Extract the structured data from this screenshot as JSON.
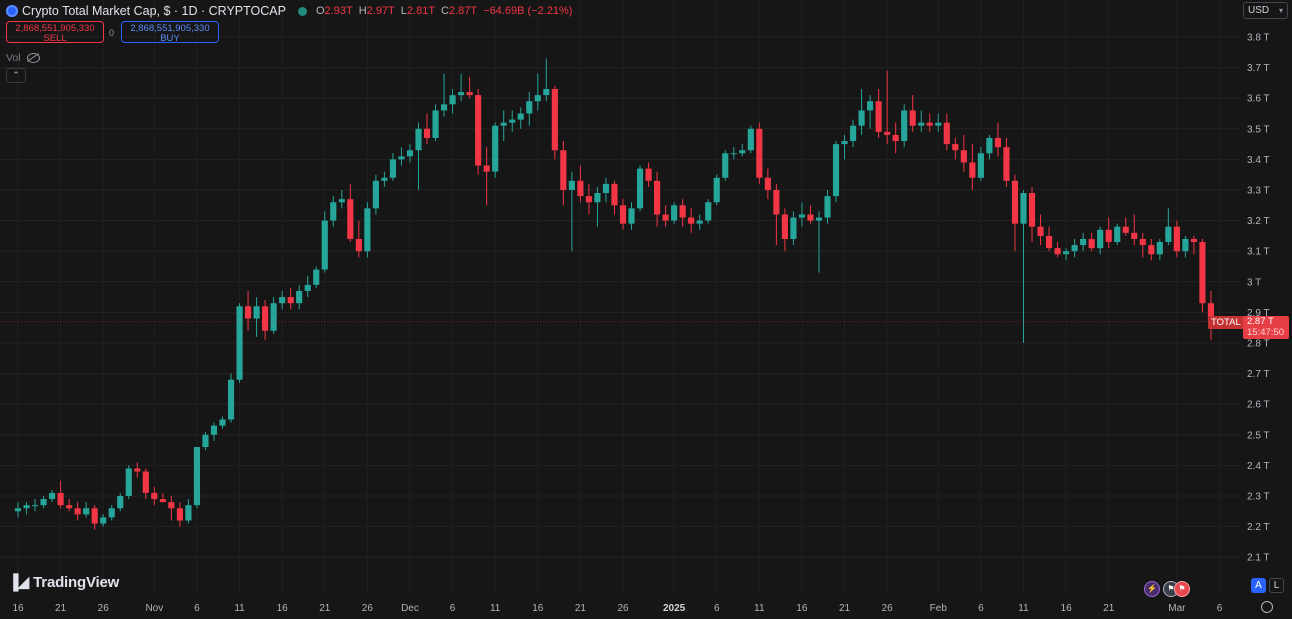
{
  "header": {
    "title": "Crypto Total Market Cap, $ · 1D · CRYPTOCAP",
    "open_label": "O",
    "open": "2.93T",
    "high_label": "H",
    "high": "2.97T",
    "low_label": "L",
    "low": "2.81T",
    "close_label": "C",
    "close": "2.87T",
    "change": "−64.69B (−2.21%)"
  },
  "trade": {
    "sell_price": "2,868,551,905,330",
    "sell_label": "SELL",
    "buy_price": "2,868,551,905,330",
    "buy_label": "BUY",
    "spread": "0"
  },
  "volume_label": "Vol",
  "currency": "USD",
  "brand": "TradingView",
  "price_tag": {
    "symbol": "TOTAL",
    "price": "2.87 T",
    "countdown": "15:47:50"
  },
  "buttons": {
    "auto": "A",
    "log": "L"
  },
  "colors": {
    "up": "#26a69a",
    "down": "#f23645",
    "background": "#161616",
    "accent": "#2962ff"
  },
  "chart_data": {
    "type": "candlestick",
    "title": "Crypto Total Market Cap, $ · 1D · CRYPTOCAP",
    "y_unit": "T (USD trillions)",
    "ylim": [
      2.0,
      3.83
    ],
    "y_ticks": [
      "2.1 T",
      "2.2 T",
      "2.3 T",
      "2.4 T",
      "2.5 T",
      "2.6 T",
      "2.7 T",
      "2.8 T",
      "2.9 T",
      "3 T",
      "3.1 T",
      "3.2 T",
      "3.3 T",
      "3.4 T",
      "3.5 T",
      "3.6 T",
      "3.7 T",
      "3.8 T"
    ],
    "x_ticks": [
      "16",
      "21",
      "26",
      "Nov",
      "6",
      "11",
      "16",
      "21",
      "26",
      "Dec",
      "6",
      "11",
      "16",
      "21",
      "26",
      "2025",
      "6",
      "11",
      "16",
      "21",
      "26",
      "Feb",
      "6",
      "11",
      "16",
      "21",
      "Mar",
      "6"
    ],
    "x_range": [
      "2024-10-16",
      "2025-03-07"
    ],
    "current_price": 2.87,
    "grid": true,
    "candles": [
      {
        "date": "2024-10-16",
        "o": 2.25,
        "h": 2.28,
        "l": 2.23,
        "c": 2.26
      },
      {
        "date": "2024-10-17",
        "o": 2.26,
        "h": 2.28,
        "l": 2.24,
        "c": 2.27
      },
      {
        "date": "2024-10-18",
        "o": 2.27,
        "h": 2.29,
        "l": 2.25,
        "c": 2.27
      },
      {
        "date": "2024-10-19",
        "o": 2.27,
        "h": 2.3,
        "l": 2.26,
        "c": 2.29
      },
      {
        "date": "2024-10-20",
        "o": 2.29,
        "h": 2.32,
        "l": 2.28,
        "c": 2.31
      },
      {
        "date": "2024-10-21",
        "o": 2.31,
        "h": 2.35,
        "l": 2.26,
        "c": 2.27
      },
      {
        "date": "2024-10-22",
        "o": 2.27,
        "h": 2.29,
        "l": 2.25,
        "c": 2.26
      },
      {
        "date": "2024-10-23",
        "o": 2.26,
        "h": 2.28,
        "l": 2.22,
        "c": 2.24
      },
      {
        "date": "2024-10-24",
        "o": 2.24,
        "h": 2.28,
        "l": 2.23,
        "c": 2.26
      },
      {
        "date": "2024-10-25",
        "o": 2.26,
        "h": 2.27,
        "l": 2.19,
        "c": 2.21
      },
      {
        "date": "2024-10-26",
        "o": 2.21,
        "h": 2.24,
        "l": 2.2,
        "c": 2.23
      },
      {
        "date": "2024-10-27",
        "o": 2.23,
        "h": 2.27,
        "l": 2.22,
        "c": 2.26
      },
      {
        "date": "2024-10-28",
        "o": 2.26,
        "h": 2.31,
        "l": 2.25,
        "c": 2.3
      },
      {
        "date": "2024-10-29",
        "o": 2.3,
        "h": 2.4,
        "l": 2.29,
        "c": 2.39
      },
      {
        "date": "2024-10-30",
        "o": 2.39,
        "h": 2.41,
        "l": 2.36,
        "c": 2.38
      },
      {
        "date": "2024-10-31",
        "o": 2.38,
        "h": 2.39,
        "l": 2.29,
        "c": 2.31
      },
      {
        "date": "2024-11-01",
        "o": 2.31,
        "h": 2.33,
        "l": 2.27,
        "c": 2.29
      },
      {
        "date": "2024-11-02",
        "o": 2.29,
        "h": 2.31,
        "l": 2.28,
        "c": 2.28
      },
      {
        "date": "2024-11-03",
        "o": 2.28,
        "h": 2.3,
        "l": 2.22,
        "c": 2.26
      },
      {
        "date": "2024-11-04",
        "o": 2.26,
        "h": 2.28,
        "l": 2.2,
        "c": 2.22
      },
      {
        "date": "2024-11-05",
        "o": 2.22,
        "h": 2.29,
        "l": 2.21,
        "c": 2.27
      },
      {
        "date": "2024-11-06",
        "o": 2.27,
        "h": 2.46,
        "l": 2.26,
        "c": 2.46
      },
      {
        "date": "2024-11-07",
        "o": 2.46,
        "h": 2.51,
        "l": 2.45,
        "c": 2.5
      },
      {
        "date": "2024-11-08",
        "o": 2.5,
        "h": 2.54,
        "l": 2.48,
        "c": 2.53
      },
      {
        "date": "2024-11-09",
        "o": 2.53,
        "h": 2.56,
        "l": 2.52,
        "c": 2.55
      },
      {
        "date": "2024-11-10",
        "o": 2.55,
        "h": 2.7,
        "l": 2.54,
        "c": 2.68
      },
      {
        "date": "2024-11-11",
        "o": 2.68,
        "h": 2.93,
        "l": 2.67,
        "c": 2.92
      },
      {
        "date": "2024-11-12",
        "o": 2.92,
        "h": 2.97,
        "l": 2.84,
        "c": 2.88
      },
      {
        "date": "2024-11-13",
        "o": 2.88,
        "h": 2.95,
        "l": 2.82,
        "c": 2.92
      },
      {
        "date": "2024-11-14",
        "o": 2.92,
        "h": 2.94,
        "l": 2.81,
        "c": 2.84
      },
      {
        "date": "2024-11-15",
        "o": 2.84,
        "h": 2.95,
        "l": 2.83,
        "c": 2.93
      },
      {
        "date": "2024-11-16",
        "o": 2.93,
        "h": 2.97,
        "l": 2.91,
        "c": 2.95
      },
      {
        "date": "2024-11-17",
        "o": 2.95,
        "h": 2.98,
        "l": 2.91,
        "c": 2.93
      },
      {
        "date": "2024-11-18",
        "o": 2.93,
        "h": 2.99,
        "l": 2.91,
        "c": 2.97
      },
      {
        "date": "2024-11-19",
        "o": 2.97,
        "h": 3.02,
        "l": 2.95,
        "c": 2.99
      },
      {
        "date": "2024-11-20",
        "o": 2.99,
        "h": 3.05,
        "l": 2.98,
        "c": 3.04
      },
      {
        "date": "2024-11-21",
        "o": 3.04,
        "h": 3.23,
        "l": 3.03,
        "c": 3.2
      },
      {
        "date": "2024-11-22",
        "o": 3.2,
        "h": 3.28,
        "l": 3.18,
        "c": 3.26
      },
      {
        "date": "2024-11-23",
        "o": 3.26,
        "h": 3.3,
        "l": 3.24,
        "c": 3.27
      },
      {
        "date": "2024-11-24",
        "o": 3.27,
        "h": 3.32,
        "l": 3.13,
        "c": 3.14
      },
      {
        "date": "2024-11-25",
        "o": 3.14,
        "h": 3.2,
        "l": 3.08,
        "c": 3.1
      },
      {
        "date": "2024-11-26",
        "o": 3.1,
        "h": 3.26,
        "l": 3.08,
        "c": 3.24
      },
      {
        "date": "2024-11-27",
        "o": 3.24,
        "h": 3.35,
        "l": 3.22,
        "c": 3.33
      },
      {
        "date": "2024-11-28",
        "o": 3.33,
        "h": 3.36,
        "l": 3.31,
        "c": 3.34
      },
      {
        "date": "2024-11-29",
        "o": 3.34,
        "h": 3.42,
        "l": 3.33,
        "c": 3.4
      },
      {
        "date": "2024-11-30",
        "o": 3.4,
        "h": 3.44,
        "l": 3.38,
        "c": 3.41
      },
      {
        "date": "2024-12-01",
        "o": 3.41,
        "h": 3.45,
        "l": 3.39,
        "c": 3.43
      },
      {
        "date": "2024-12-02",
        "o": 3.43,
        "h": 3.52,
        "l": 3.3,
        "c": 3.5
      },
      {
        "date": "2024-12-03",
        "o": 3.5,
        "h": 3.55,
        "l": 3.45,
        "c": 3.47
      },
      {
        "date": "2024-12-04",
        "o": 3.47,
        "h": 3.58,
        "l": 3.46,
        "c": 3.56
      },
      {
        "date": "2024-12-05",
        "o": 3.56,
        "h": 3.68,
        "l": 3.54,
        "c": 3.58
      },
      {
        "date": "2024-12-06",
        "o": 3.58,
        "h": 3.63,
        "l": 3.55,
        "c": 3.61
      },
      {
        "date": "2024-12-07",
        "o": 3.61,
        "h": 3.68,
        "l": 3.59,
        "c": 3.62
      },
      {
        "date": "2024-12-08",
        "o": 3.62,
        "h": 3.67,
        "l": 3.6,
        "c": 3.61
      },
      {
        "date": "2024-12-09",
        "o": 3.61,
        "h": 3.63,
        "l": 3.35,
        "c": 3.38
      },
      {
        "date": "2024-12-10",
        "o": 3.38,
        "h": 3.44,
        "l": 3.25,
        "c": 3.36
      },
      {
        "date": "2024-12-11",
        "o": 3.36,
        "h": 3.52,
        "l": 3.34,
        "c": 3.51
      },
      {
        "date": "2024-12-12",
        "o": 3.51,
        "h": 3.56,
        "l": 3.46,
        "c": 3.52
      },
      {
        "date": "2024-12-13",
        "o": 3.52,
        "h": 3.56,
        "l": 3.49,
        "c": 3.53
      },
      {
        "date": "2024-12-14",
        "o": 3.53,
        "h": 3.57,
        "l": 3.5,
        "c": 3.55
      },
      {
        "date": "2024-12-15",
        "o": 3.55,
        "h": 3.62,
        "l": 3.51,
        "c": 3.59
      },
      {
        "date": "2024-12-16",
        "o": 3.59,
        "h": 3.68,
        "l": 3.56,
        "c": 3.61
      },
      {
        "date": "2024-12-17",
        "o": 3.61,
        "h": 3.73,
        "l": 3.59,
        "c": 3.63
      },
      {
        "date": "2024-12-18",
        "o": 3.63,
        "h": 3.64,
        "l": 3.4,
        "c": 3.43
      },
      {
        "date": "2024-12-19",
        "o": 3.43,
        "h": 3.46,
        "l": 3.25,
        "c": 3.3
      },
      {
        "date": "2024-12-20",
        "o": 3.3,
        "h": 3.36,
        "l": 3.1,
        "c": 3.33
      },
      {
        "date": "2024-12-21",
        "o": 3.33,
        "h": 3.38,
        "l": 3.26,
        "c": 3.28
      },
      {
        "date": "2024-12-22",
        "o": 3.28,
        "h": 3.32,
        "l": 3.22,
        "c": 3.26
      },
      {
        "date": "2024-12-23",
        "o": 3.26,
        "h": 3.31,
        "l": 3.18,
        "c": 3.29
      },
      {
        "date": "2024-12-24",
        "o": 3.29,
        "h": 3.34,
        "l": 3.26,
        "c": 3.32
      },
      {
        "date": "2024-12-25",
        "o": 3.32,
        "h": 3.33,
        "l": 3.22,
        "c": 3.25
      },
      {
        "date": "2024-12-26",
        "o": 3.25,
        "h": 3.27,
        "l": 3.17,
        "c": 3.19
      },
      {
        "date": "2024-12-27",
        "o": 3.19,
        "h": 3.26,
        "l": 3.17,
        "c": 3.24
      },
      {
        "date": "2024-12-28",
        "o": 3.24,
        "h": 3.38,
        "l": 3.23,
        "c": 3.37
      },
      {
        "date": "2024-12-29",
        "o": 3.37,
        "h": 3.39,
        "l": 3.31,
        "c": 3.33
      },
      {
        "date": "2024-12-30",
        "o": 3.33,
        "h": 3.36,
        "l": 3.18,
        "c": 3.22
      },
      {
        "date": "2024-12-31",
        "o": 3.22,
        "h": 3.25,
        "l": 3.18,
        "c": 3.2
      },
      {
        "date": "2025-01-01",
        "o": 3.2,
        "h": 3.26,
        "l": 3.19,
        "c": 3.25
      },
      {
        "date": "2025-01-02",
        "o": 3.25,
        "h": 3.27,
        "l": 3.18,
        "c": 3.21
      },
      {
        "date": "2025-01-03",
        "o": 3.21,
        "h": 3.24,
        "l": 3.16,
        "c": 3.19
      },
      {
        "date": "2025-01-04",
        "o": 3.19,
        "h": 3.22,
        "l": 3.17,
        "c": 3.2
      },
      {
        "date": "2025-01-05",
        "o": 3.2,
        "h": 3.27,
        "l": 3.19,
        "c": 3.26
      },
      {
        "date": "2025-01-06",
        "o": 3.26,
        "h": 3.35,
        "l": 3.25,
        "c": 3.34
      },
      {
        "date": "2025-01-07",
        "o": 3.34,
        "h": 3.43,
        "l": 3.33,
        "c": 3.42
      },
      {
        "date": "2025-01-08",
        "o": 3.42,
        "h": 3.44,
        "l": 3.4,
        "c": 3.42
      },
      {
        "date": "2025-01-09",
        "o": 3.42,
        "h": 3.45,
        "l": 3.41,
        "c": 3.43
      },
      {
        "date": "2025-01-10",
        "o": 3.43,
        "h": 3.51,
        "l": 3.42,
        "c": 3.5
      },
      {
        "date": "2025-01-11",
        "o": 3.5,
        "h": 3.52,
        "l": 3.32,
        "c": 3.34
      },
      {
        "date": "2025-01-12",
        "o": 3.34,
        "h": 3.37,
        "l": 3.27,
        "c": 3.3
      },
      {
        "date": "2025-01-13",
        "o": 3.3,
        "h": 3.32,
        "l": 3.12,
        "c": 3.22
      },
      {
        "date": "2025-01-14",
        "o": 3.22,
        "h": 3.24,
        "l": 3.1,
        "c": 3.14
      },
      {
        "date": "2025-01-15",
        "o": 3.14,
        "h": 3.23,
        "l": 3.12,
        "c": 3.21
      },
      {
        "date": "2025-01-16",
        "o": 3.21,
        "h": 3.26,
        "l": 3.18,
        "c": 3.22
      },
      {
        "date": "2025-01-17",
        "o": 3.22,
        "h": 3.25,
        "l": 3.19,
        "c": 3.2
      },
      {
        "date": "2025-01-18",
        "o": 3.2,
        "h": 3.23,
        "l": 3.03,
        "c": 3.21
      },
      {
        "date": "2025-01-19",
        "o": 3.21,
        "h": 3.3,
        "l": 3.19,
        "c": 3.28
      },
      {
        "date": "2025-01-20",
        "o": 3.28,
        "h": 3.46,
        "l": 3.26,
        "c": 3.45
      },
      {
        "date": "2025-01-21",
        "o": 3.45,
        "h": 3.48,
        "l": 3.4,
        "c": 3.46
      },
      {
        "date": "2025-01-22",
        "o": 3.46,
        "h": 3.53,
        "l": 3.44,
        "c": 3.51
      },
      {
        "date": "2025-01-23",
        "o": 3.51,
        "h": 3.63,
        "l": 3.48,
        "c": 3.56
      },
      {
        "date": "2025-01-24",
        "o": 3.56,
        "h": 3.61,
        "l": 3.5,
        "c": 3.59
      },
      {
        "date": "2025-01-25",
        "o": 3.59,
        "h": 3.63,
        "l": 3.47,
        "c": 3.49
      },
      {
        "date": "2025-01-26",
        "o": 3.49,
        "h": 3.69,
        "l": 3.45,
        "c": 3.48
      },
      {
        "date": "2025-01-27",
        "o": 3.48,
        "h": 3.52,
        "l": 3.42,
        "c": 3.46
      },
      {
        "date": "2025-01-28",
        "o": 3.46,
        "h": 3.58,
        "l": 3.44,
        "c": 3.56
      },
      {
        "date": "2025-01-29",
        "o": 3.56,
        "h": 3.61,
        "l": 3.49,
        "c": 3.51
      },
      {
        "date": "2025-01-30",
        "o": 3.51,
        "h": 3.56,
        "l": 3.49,
        "c": 3.52
      },
      {
        "date": "2025-01-31",
        "o": 3.52,
        "h": 3.55,
        "l": 3.49,
        "c": 3.51
      },
      {
        "date": "2025-02-01",
        "o": 3.51,
        "h": 3.55,
        "l": 3.49,
        "c": 3.52
      },
      {
        "date": "2025-02-02",
        "o": 3.52,
        "h": 3.55,
        "l": 3.43,
        "c": 3.45
      },
      {
        "date": "2025-02-03",
        "o": 3.45,
        "h": 3.47,
        "l": 3.4,
        "c": 3.43
      },
      {
        "date": "2025-02-04",
        "o": 3.43,
        "h": 3.48,
        "l": 3.36,
        "c": 3.39
      },
      {
        "date": "2025-02-05",
        "o": 3.39,
        "h": 3.45,
        "l": 3.3,
        "c": 3.34
      },
      {
        "date": "2025-02-06",
        "o": 3.34,
        "h": 3.44,
        "l": 3.33,
        "c": 3.42
      },
      {
        "date": "2025-02-07",
        "o": 3.42,
        "h": 3.48,
        "l": 3.4,
        "c": 3.47
      },
      {
        "date": "2025-02-08",
        "o": 3.47,
        "h": 3.52,
        "l": 3.41,
        "c": 3.44
      },
      {
        "date": "2025-02-09",
        "o": 3.44,
        "h": 3.47,
        "l": 3.31,
        "c": 3.33
      },
      {
        "date": "2025-02-10",
        "o": 3.33,
        "h": 3.35,
        "l": 3.1,
        "c": 3.19
      },
      {
        "date": "2025-02-11",
        "o": 3.19,
        "h": 3.3,
        "l": 2.8,
        "c": 3.29
      },
      {
        "date": "2025-02-12",
        "o": 3.29,
        "h": 3.31,
        "l": 3.13,
        "c": 3.18
      },
      {
        "date": "2025-02-13",
        "o": 3.18,
        "h": 3.22,
        "l": 3.12,
        "c": 3.15
      },
      {
        "date": "2025-02-14",
        "o": 3.15,
        "h": 3.18,
        "l": 3.1,
        "c": 3.11
      },
      {
        "date": "2025-02-15",
        "o": 3.11,
        "h": 3.13,
        "l": 3.08,
        "c": 3.09
      },
      {
        "date": "2025-02-16",
        "o": 3.09,
        "h": 3.11,
        "l": 3.07,
        "c": 3.1
      },
      {
        "date": "2025-02-17",
        "o": 3.1,
        "h": 3.14,
        "l": 3.08,
        "c": 3.12
      },
      {
        "date": "2025-02-18",
        "o": 3.12,
        "h": 3.16,
        "l": 3.1,
        "c": 3.14
      },
      {
        "date": "2025-02-19",
        "o": 3.14,
        "h": 3.16,
        "l": 3.1,
        "c": 3.11
      },
      {
        "date": "2025-02-20",
        "o": 3.11,
        "h": 3.18,
        "l": 3.09,
        "c": 3.17
      },
      {
        "date": "2025-02-21",
        "o": 3.17,
        "h": 3.21,
        "l": 3.11,
        "c": 3.13
      },
      {
        "date": "2025-02-22",
        "o": 3.13,
        "h": 3.19,
        "l": 3.12,
        "c": 3.18
      },
      {
        "date": "2025-02-23",
        "o": 3.18,
        "h": 3.21,
        "l": 3.15,
        "c": 3.16
      },
      {
        "date": "2025-02-24",
        "o": 3.16,
        "h": 3.22,
        "l": 3.12,
        "c": 3.14
      },
      {
        "date": "2025-02-25",
        "o": 3.14,
        "h": 3.16,
        "l": 3.08,
        "c": 3.12
      },
      {
        "date": "2025-02-26",
        "o": 3.12,
        "h": 3.14,
        "l": 3.07,
        "c": 3.09
      },
      {
        "date": "2025-02-27",
        "o": 3.09,
        "h": 3.14,
        "l": 3.07,
        "c": 3.13
      },
      {
        "date": "2025-02-28",
        "o": 3.13,
        "h": 3.24,
        "l": 3.12,
        "c": 3.18
      },
      {
        "date": "2025-03-01",
        "o": 3.18,
        "h": 3.2,
        "l": 3.08,
        "c": 3.1
      },
      {
        "date": "2025-03-02",
        "o": 3.1,
        "h": 3.15,
        "l": 3.08,
        "c": 3.14
      },
      {
        "date": "2025-03-03",
        "o": 3.14,
        "h": 3.15,
        "l": 3.09,
        "c": 3.13
      },
      {
        "date": "2025-03-04",
        "o": 3.13,
        "h": 3.14,
        "l": 2.9,
        "c": 2.93
      },
      {
        "date": "2025-03-05",
        "o": 2.93,
        "h": 2.97,
        "l": 2.81,
        "c": 2.87
      }
    ]
  }
}
